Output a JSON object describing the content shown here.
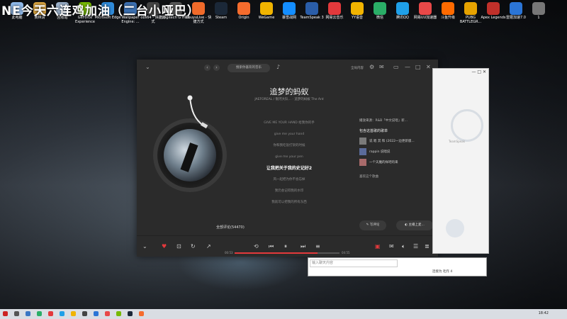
{
  "overlay": {
    "title": "NE今天六连鸡加油（二台小哑巴）"
  },
  "desktop_icons": [
    {
      "label": "此电脑",
      "color": "#8fb8e8"
    },
    {
      "label": "黄林清",
      "color": "#d9a441"
    },
    {
      "label": "回收站",
      "color": "#9bb0c9"
    },
    {
      "label": "GeForce Experience",
      "color": "#76b900"
    },
    {
      "label": "Microsoft Edge",
      "color": "#2f8ad8"
    },
    {
      "label": "Wallpaper Engine: ...",
      "color": "#3b6fb0"
    },
    {
      "label": "obs64 - 快捷方式",
      "color": "#444"
    },
    {
      "label": "Logitech G HUB",
      "color": "#5a5a5a"
    },
    {
      "label": "DouyuLive - 快捷方式",
      "color": "#f06a2a"
    },
    {
      "label": "Steam",
      "color": "#1b2838"
    },
    {
      "label": "Origin",
      "color": "#f56c2d"
    },
    {
      "label": "WeGame",
      "color": "#f0b400"
    },
    {
      "label": "暴雪战网",
      "color": "#148eff"
    },
    {
      "label": "TeamSpeak 3",
      "color": "#2a5da8"
    },
    {
      "label": "网易云音乐",
      "color": "#e3393c"
    },
    {
      "label": "YY语音",
      "color": "#f2b400"
    },
    {
      "label": "微信",
      "color": "#2aae67"
    },
    {
      "label": "腾讯QQ",
      "color": "#1fa0e8"
    },
    {
      "label": "网易UU加速器",
      "color": "#e84848"
    },
    {
      "label": "斗鱼升级",
      "color": "#ff6a00"
    },
    {
      "label": "PUBG BATTLEGR...",
      "color": "#e6a200"
    },
    {
      "label": "Apex Legends",
      "color": "#c0302a"
    },
    {
      "label": "雷霆加速7.0",
      "color": "#2b75d6"
    },
    {
      "label": "1",
      "color": "#777"
    }
  ],
  "player": {
    "search_placeholder": "搜索你喜欢的音乐",
    "titlebar_label": "全局内容",
    "song_title": "追梦的蚂蚁",
    "song_meta": "JAEFOREAL / 银河大队...  ·  追梦的蚂蚁 The Ant",
    "lyrics": [
      "GIVE ME YOUR HAND 给我你的手",
      "give me your hand",
      "你和我吃饭打架的时候",
      "give me your pen",
      "让我把关于我的史记好2",
      "风一起把为你不会忘掉",
      "我仍会记得我的水印",
      "我就可以把我的所有东西"
    ],
    "active_lyric_index": 4,
    "comments_link": "全部评论(54470)",
    "right_panel": {
      "source": "播放来源：R&B「中文说唱」新...",
      "playlists_header": "包含这首歌的歌单",
      "playlists": [
        {
          "title": "说 唱 其 和 (2022一边更新版..."
        },
        {
          "title": "rappin 说唱说"
        },
        {
          "title": "一个天魔的样吧的来"
        }
      ],
      "similar": "喜欢这个歌曲"
    },
    "write_comment": "写评论",
    "share_label": "主播上麦...",
    "time_elapsed": "00:53",
    "time_total": "04:55",
    "progress": 0.79
  },
  "side_window": {
    "caption": "TeamSpeak"
  },
  "chat": {
    "input_placeholder": "输入聊天内容",
    "tray_text": "连接为  毛炸  4"
  },
  "taskbar": {
    "clock": "18:42"
  }
}
